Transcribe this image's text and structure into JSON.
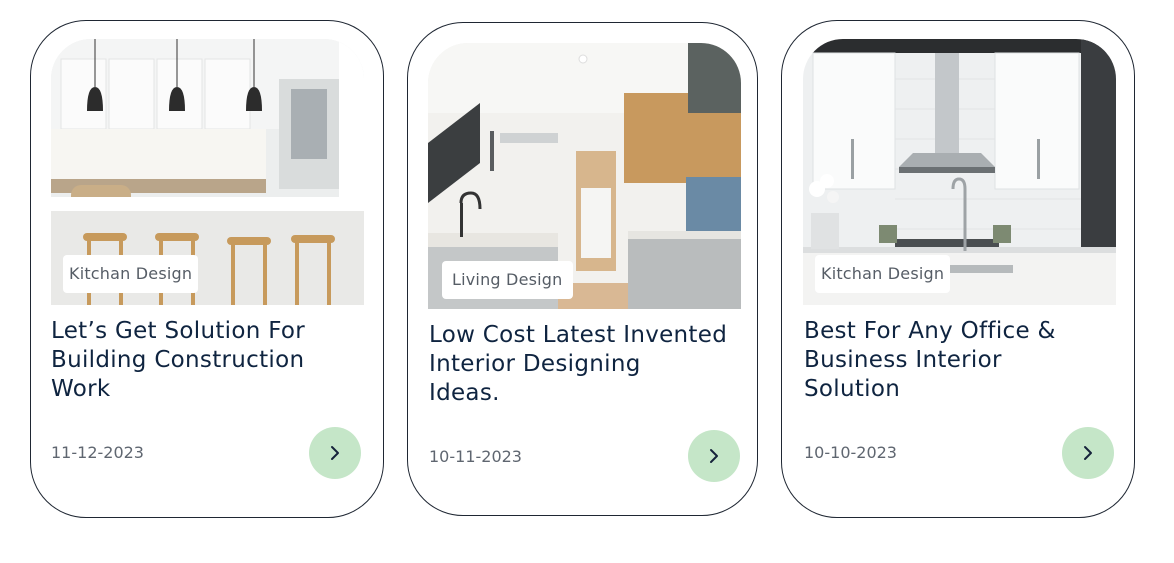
{
  "cards": [
    {
      "tag": "Kitchan Design",
      "title_lines": [
        "Let’s Get Solution For",
        "Building Construction",
        "Work"
      ],
      "date": "11-12-2023",
      "next_icon": "chevron-right-icon"
    },
    {
      "tag": "Living Design",
      "title_lines": [
        "Low Cost Latest Invented",
        "Interior Designing",
        "Ideas."
      ],
      "date": "10-11-2023",
      "next_icon": "chevron-right-icon"
    },
    {
      "tag": "Kitchan Design",
      "title_lines": [
        "Best For Any Office &",
        "Business Interior",
        "Solution"
      ],
      "date": "10-10-2023",
      "next_icon": "chevron-right-icon"
    }
  ],
  "colors": {
    "border": "#1f2733",
    "title": "#0f2440",
    "button": "#c5e6c8",
    "date": "#5f6670"
  }
}
